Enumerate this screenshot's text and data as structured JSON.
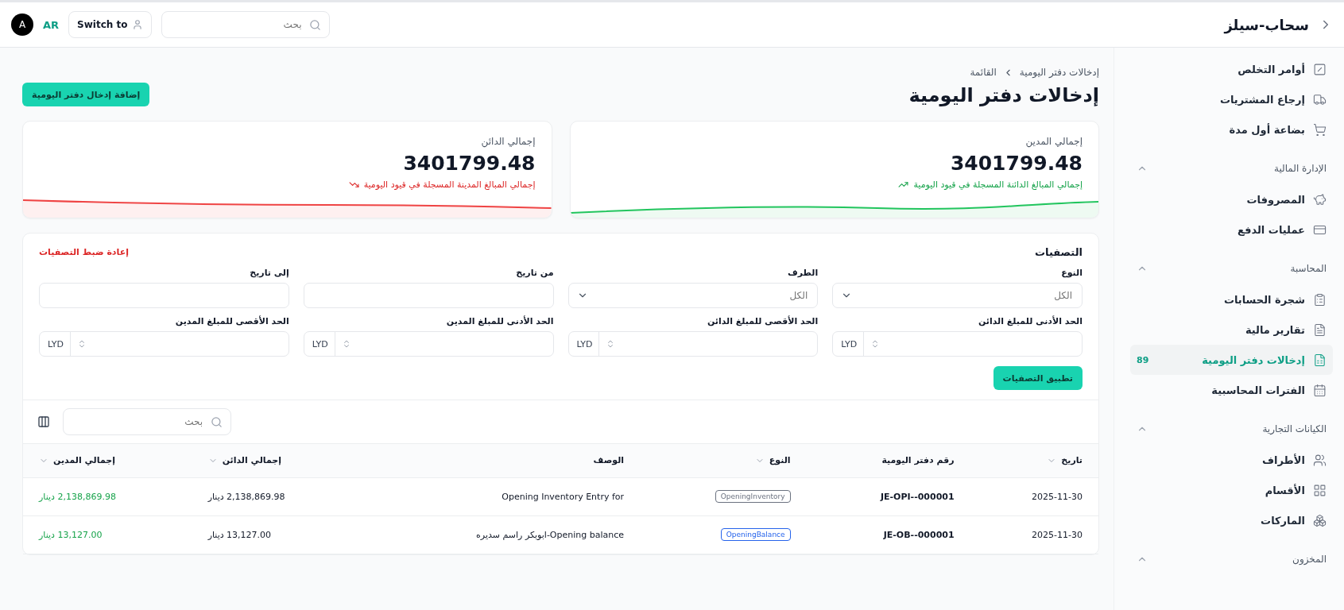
{
  "brand": {
    "name": "سحاب-سيلز"
  },
  "topbar": {
    "search_placeholder": "بحث",
    "switch_label": "Switch to",
    "language": "AR",
    "avatar": "A"
  },
  "sidebar": {
    "groups": [
      {
        "items": [
          {
            "label": "أوامر التخلص",
            "selected": false
          },
          {
            "label": "إرجاع المشتريات",
            "selected": false
          },
          {
            "label": "بضاعة أول مدة",
            "selected": false
          }
        ]
      },
      {
        "title": "الإدارة المالية",
        "expanded": true,
        "items": [
          {
            "label": "المصروفات",
            "selected": false
          },
          {
            "label": "عمليات الدفع",
            "selected": false
          }
        ]
      },
      {
        "title": "المحاسبة",
        "expanded": true,
        "items": [
          {
            "label": "شجرة الحسابات",
            "selected": false
          },
          {
            "label": "تقارير مالية",
            "selected": false
          },
          {
            "label": "إدخالات دفتر اليومية",
            "selected": true,
            "badge": "89"
          },
          {
            "label": "الفترات المحاسبية",
            "selected": false
          }
        ]
      },
      {
        "title": "الكيانات التجارية",
        "expanded": true,
        "items": [
          {
            "label": "الأطراف",
            "selected": false
          },
          {
            "label": "الأقسام",
            "selected": false
          },
          {
            "label": "الماركات",
            "selected": false
          }
        ]
      },
      {
        "title": "المخزون",
        "expanded": true
      }
    ]
  },
  "breadcrumb": [
    "إدخالات دفتر اليومية",
    "القائمة"
  ],
  "title": "إدخالات دفتر اليومية",
  "add_button": "إضافة إدخال دفتر اليومية",
  "cards": [
    {
      "label": "إجمالي المدين",
      "value": "3401799.48",
      "note": "إجمالي المبالغ الدائنة المسجلة في قيود اليومية",
      "color": "#16a34a"
    },
    {
      "label": "إجمالي الدائن",
      "value": "3401799.48",
      "note": "إجمالي المبالغ المدينة المسجلة في قيود اليومية",
      "color": "#dc2626"
    }
  ],
  "filters": {
    "title": "التصفيات",
    "reset": "إعادة ضبط التصفيات",
    "apply": "تطبيق التصفيات",
    "fields": [
      {
        "kind": "select",
        "label": "النوع",
        "placeholder": "الكل"
      },
      {
        "kind": "select",
        "label": "الطرف",
        "placeholder": "الكل"
      },
      {
        "kind": "date",
        "label": "من تاريخ"
      },
      {
        "kind": "date",
        "label": "إلى تاريخ"
      },
      {
        "kind": "amount",
        "label": "الحد الأدنى للمبلغ الدائن",
        "currency": "LYD"
      },
      {
        "kind": "amount",
        "label": "الحد الأقصى للمبلغ الدائن",
        "currency": "LYD"
      },
      {
        "kind": "amount",
        "label": "الحد الأدنى للمبلغ المدين",
        "currency": "LYD"
      },
      {
        "kind": "amount",
        "label": "الحد الأقصى للمبلغ المدين",
        "currency": "LYD"
      }
    ]
  },
  "table": {
    "search_placeholder": "بحث",
    "columns": [
      {
        "label": "تاريخ",
        "sortable": true
      },
      {
        "label": "رقم دفتر اليومية",
        "sortable": false
      },
      {
        "label": "النوع",
        "sortable": true
      },
      {
        "label": "الوصف",
        "sortable": false
      },
      {
        "label": "إجمالي الدائن",
        "sortable": true
      },
      {
        "label": "إجمالي المدين",
        "sortable": true
      }
    ],
    "rows": [
      {
        "date": "2025-11-30",
        "number": "JE-OPI--000001",
        "type": {
          "label": "OpeningInventory",
          "color": "#6b7280"
        },
        "description": "Opening Inventory Entry for",
        "credit": "2,138,869.98 دينار",
        "debit": "2,138,869.98 دينار"
      },
      {
        "date": "2025-11-30",
        "number": "JE-OB--000001",
        "type": {
          "label": "OpeningBalance",
          "color": "#2563eb"
        },
        "description": "Opening balance-ابوبكر راسم سديره",
        "credit": "13,127.00 دينار",
        "debit": "13,127.00 دينار"
      }
    ]
  }
}
